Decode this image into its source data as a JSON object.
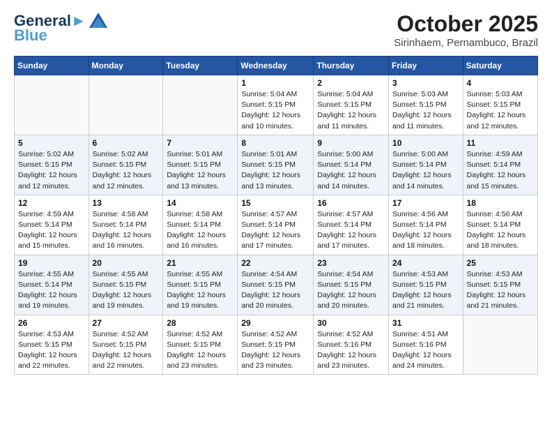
{
  "header": {
    "logo_line1": "General",
    "logo_line2": "Blue",
    "month_title": "October 2025",
    "location": "Sirinhaem, Pernambuco, Brazil"
  },
  "days_of_week": [
    "Sunday",
    "Monday",
    "Tuesday",
    "Wednesday",
    "Thursday",
    "Friday",
    "Saturday"
  ],
  "weeks": [
    [
      {
        "day": "",
        "info": ""
      },
      {
        "day": "",
        "info": ""
      },
      {
        "day": "",
        "info": ""
      },
      {
        "day": "1",
        "info": "Sunrise: 5:04 AM\nSunset: 5:15 PM\nDaylight: 12 hours\nand 10 minutes."
      },
      {
        "day": "2",
        "info": "Sunrise: 5:04 AM\nSunset: 5:15 PM\nDaylight: 12 hours\nand 11 minutes."
      },
      {
        "day": "3",
        "info": "Sunrise: 5:03 AM\nSunset: 5:15 PM\nDaylight: 12 hours\nand 11 minutes."
      },
      {
        "day": "4",
        "info": "Sunrise: 5:03 AM\nSunset: 5:15 PM\nDaylight: 12 hours\nand 12 minutes."
      }
    ],
    [
      {
        "day": "5",
        "info": "Sunrise: 5:02 AM\nSunset: 5:15 PM\nDaylight: 12 hours\nand 12 minutes."
      },
      {
        "day": "6",
        "info": "Sunrise: 5:02 AM\nSunset: 5:15 PM\nDaylight: 12 hours\nand 12 minutes."
      },
      {
        "day": "7",
        "info": "Sunrise: 5:01 AM\nSunset: 5:15 PM\nDaylight: 12 hours\nand 13 minutes."
      },
      {
        "day": "8",
        "info": "Sunrise: 5:01 AM\nSunset: 5:15 PM\nDaylight: 12 hours\nand 13 minutes."
      },
      {
        "day": "9",
        "info": "Sunrise: 5:00 AM\nSunset: 5:14 PM\nDaylight: 12 hours\nand 14 minutes."
      },
      {
        "day": "10",
        "info": "Sunrise: 5:00 AM\nSunset: 5:14 PM\nDaylight: 12 hours\nand 14 minutes."
      },
      {
        "day": "11",
        "info": "Sunrise: 4:59 AM\nSunset: 5:14 PM\nDaylight: 12 hours\nand 15 minutes."
      }
    ],
    [
      {
        "day": "12",
        "info": "Sunrise: 4:59 AM\nSunset: 5:14 PM\nDaylight: 12 hours\nand 15 minutes."
      },
      {
        "day": "13",
        "info": "Sunrise: 4:58 AM\nSunset: 5:14 PM\nDaylight: 12 hours\nand 16 minutes."
      },
      {
        "day": "14",
        "info": "Sunrise: 4:58 AM\nSunset: 5:14 PM\nDaylight: 12 hours\nand 16 minutes."
      },
      {
        "day": "15",
        "info": "Sunrise: 4:57 AM\nSunset: 5:14 PM\nDaylight: 12 hours\nand 17 minutes."
      },
      {
        "day": "16",
        "info": "Sunrise: 4:57 AM\nSunset: 5:14 PM\nDaylight: 12 hours\nand 17 minutes."
      },
      {
        "day": "17",
        "info": "Sunrise: 4:56 AM\nSunset: 5:14 PM\nDaylight: 12 hours\nand 18 minutes."
      },
      {
        "day": "18",
        "info": "Sunrise: 4:56 AM\nSunset: 5:14 PM\nDaylight: 12 hours\nand 18 minutes."
      }
    ],
    [
      {
        "day": "19",
        "info": "Sunrise: 4:55 AM\nSunset: 5:14 PM\nDaylight: 12 hours\nand 19 minutes."
      },
      {
        "day": "20",
        "info": "Sunrise: 4:55 AM\nSunset: 5:15 PM\nDaylight: 12 hours\nand 19 minutes."
      },
      {
        "day": "21",
        "info": "Sunrise: 4:55 AM\nSunset: 5:15 PM\nDaylight: 12 hours\nand 19 minutes."
      },
      {
        "day": "22",
        "info": "Sunrise: 4:54 AM\nSunset: 5:15 PM\nDaylight: 12 hours\nand 20 minutes."
      },
      {
        "day": "23",
        "info": "Sunrise: 4:54 AM\nSunset: 5:15 PM\nDaylight: 12 hours\nand 20 minutes."
      },
      {
        "day": "24",
        "info": "Sunrise: 4:53 AM\nSunset: 5:15 PM\nDaylight: 12 hours\nand 21 minutes."
      },
      {
        "day": "25",
        "info": "Sunrise: 4:53 AM\nSunset: 5:15 PM\nDaylight: 12 hours\nand 21 minutes."
      }
    ],
    [
      {
        "day": "26",
        "info": "Sunrise: 4:53 AM\nSunset: 5:15 PM\nDaylight: 12 hours\nand 22 minutes."
      },
      {
        "day": "27",
        "info": "Sunrise: 4:52 AM\nSunset: 5:15 PM\nDaylight: 12 hours\nand 22 minutes."
      },
      {
        "day": "28",
        "info": "Sunrise: 4:52 AM\nSunset: 5:15 PM\nDaylight: 12 hours\nand 23 minutes."
      },
      {
        "day": "29",
        "info": "Sunrise: 4:52 AM\nSunset: 5:15 PM\nDaylight: 12 hours\nand 23 minutes."
      },
      {
        "day": "30",
        "info": "Sunrise: 4:52 AM\nSunset: 5:16 PM\nDaylight: 12 hours\nand 23 minutes."
      },
      {
        "day": "31",
        "info": "Sunrise: 4:51 AM\nSunset: 5:16 PM\nDaylight: 12 hours\nand 24 minutes."
      },
      {
        "day": "",
        "info": ""
      }
    ]
  ]
}
